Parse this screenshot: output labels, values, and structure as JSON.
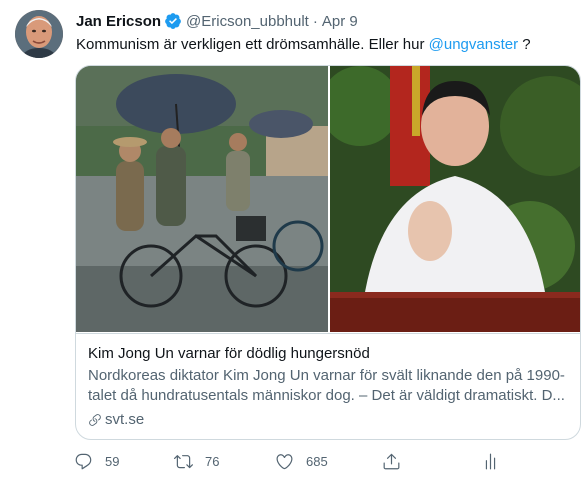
{
  "author": {
    "name": "Jan Ericson",
    "handle": "@Ericson_ubbhult",
    "separator": "·",
    "date": "Apr 9",
    "avatar_icon": "user-avatar-photo",
    "verified_icon": "verified-badge-icon"
  },
  "tweet": {
    "text": "Kommunism är verkligen ett drömsamhälle. Eller hur ",
    "mention": "@ungvanster",
    "trailing": " ?"
  },
  "card": {
    "title": "Kim Jong Un varnar för dödlig hungersnöd",
    "description_line1": "Nordkoreas diktator Kim Jong Un varnar för svält liknande den på 1990-",
    "description_line2": "talet då hundratusentals människor dog. – Det är väldigt dramatiskt. D...",
    "domain": "svt.se",
    "left_image": "photo-cyclists-with-umbrellas",
    "right_image": "photo-man-clapping-at-podium"
  },
  "actions": {
    "replies": "59",
    "retweets": "76",
    "likes": "685"
  },
  "colors": {
    "accent": "#1d9bf0",
    "text": "#0f1419",
    "muted": "#536471",
    "border": "#cfd9de"
  }
}
